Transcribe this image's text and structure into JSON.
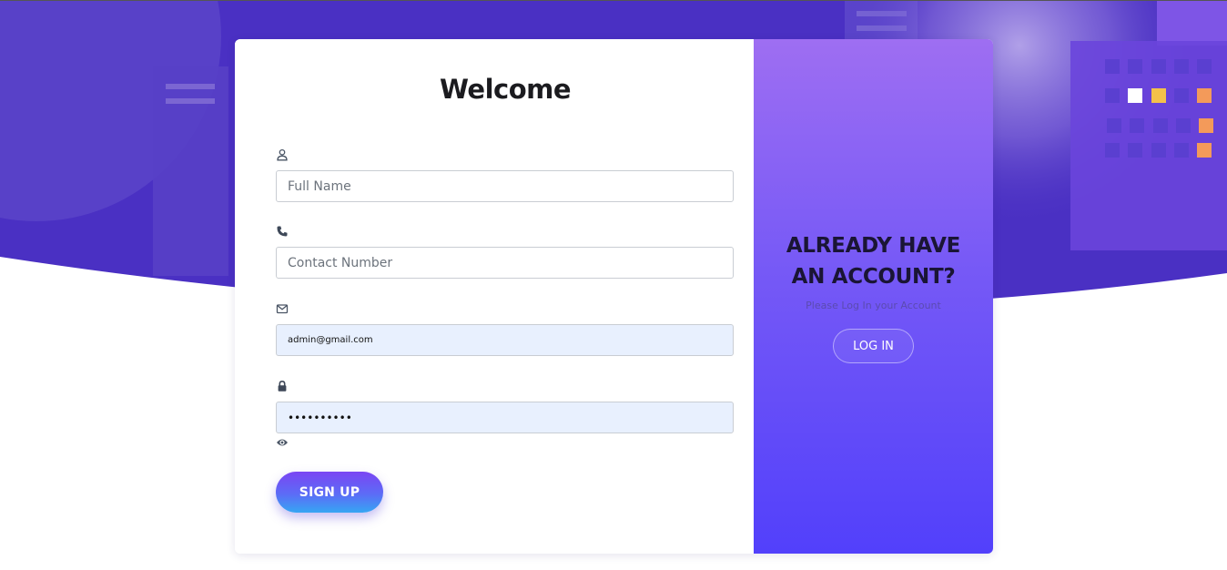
{
  "form": {
    "title": "Welcome",
    "fields": {
      "full_name": {
        "icon": "user-icon",
        "placeholder": "Full Name",
        "value": ""
      },
      "contact": {
        "icon": "phone-icon",
        "placeholder": "Contact Number",
        "value": ""
      },
      "email": {
        "icon": "envelope-icon",
        "placeholder": "",
        "value": "admin@gmail.com"
      },
      "password": {
        "icon": "lock-icon",
        "placeholder": "",
        "value": "••••••••••"
      }
    },
    "toggle_icon": "eye-icon",
    "signup_label": "SIGN UP"
  },
  "side": {
    "heading_line1": "ALREADY HAVE",
    "heading_line2": "AN ACCOUNT?",
    "subtext": "Please Log In your Account",
    "login_label": "LOG IN"
  },
  "colors": {
    "bg_primary": "#4a30c3",
    "panel_top": "#9e6ef2",
    "panel_bottom": "#5240fb",
    "input_autofill": "#e8f0fe"
  }
}
